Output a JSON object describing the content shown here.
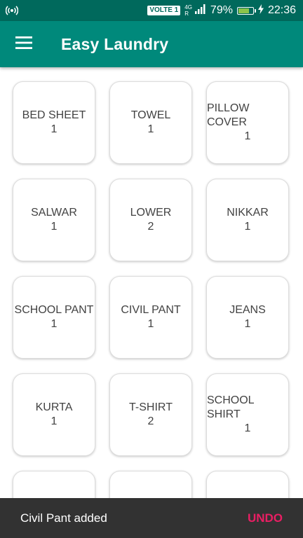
{
  "status_bar": {
    "network_badge": "VOLTE 1",
    "network_type": "4G",
    "network_sub": "R",
    "battery_percent": "79%",
    "battery_level": 0.79,
    "time": "22:36",
    "icons": [
      "hotspot-icon",
      "signal-icon",
      "battery-icon",
      "charging-icon"
    ]
  },
  "app_bar": {
    "title": "Easy Laundry",
    "menu_icon": "hamburger-menu-icon"
  },
  "items": [
    {
      "name": "BED SHEET",
      "count": "1"
    },
    {
      "name": "TOWEL",
      "count": "1"
    },
    {
      "name": "PILLOW COVER",
      "count": "1"
    },
    {
      "name": "SALWAR",
      "count": "1"
    },
    {
      "name": "LOWER",
      "count": "2"
    },
    {
      "name": "NIKKAR",
      "count": "1"
    },
    {
      "name": "SCHOOL PANT",
      "count": "1"
    },
    {
      "name": "CIVIL PANT",
      "count": "1"
    },
    {
      "name": "JEANS",
      "count": "1"
    },
    {
      "name": "KURTA",
      "count": "1"
    },
    {
      "name": "T-SHIRT",
      "count": "2"
    },
    {
      "name": "SCHOOL SHIRT",
      "count": "1"
    },
    {
      "name": "",
      "count": ""
    },
    {
      "name": "",
      "count": ""
    },
    {
      "name": "",
      "count": ""
    }
  ],
  "snackbar": {
    "message": "Civil Pant added",
    "action": "UNDO"
  },
  "colors": {
    "status_bar": "#00695c",
    "app_bar": "#00897b",
    "snackbar_bg": "#323232",
    "snackbar_action": "#e91e63"
  }
}
